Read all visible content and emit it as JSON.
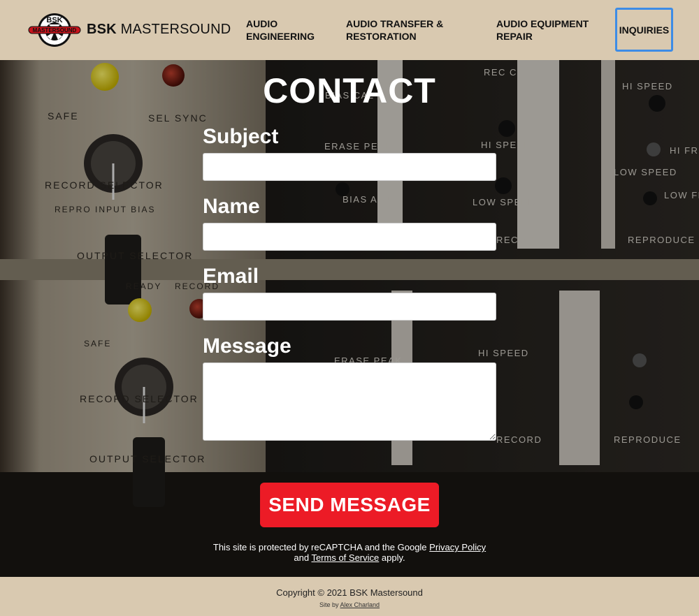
{
  "header": {
    "brand_bold": "BSK",
    "brand_rest": "MASTERSOUND",
    "logo": {
      "top_text": "BSK",
      "band_text": "MASTERSOUND"
    },
    "nav": [
      {
        "label": "AUDIO ENGINEERING"
      },
      {
        "label": "AUDIO TRANSFER & RESTORATION"
      },
      {
        "label": "AUDIO EQUIPMENT REPAIR"
      },
      {
        "label": "INQUIRIES"
      }
    ]
  },
  "hero": {
    "panel_labels": {
      "safe": "SAFE",
      "sel_sync": "SEL SYNC",
      "record_selector": "RECORD SELECTOR",
      "repro_input_bias": "REPRO  INPUT  BIAS",
      "output_selector": "OUTPUT SELECTOR",
      "ready": "READY",
      "record": "RECORD",
      "bias_cal": "BIAS CAL",
      "rec_cal": "REC CAL",
      "erase_peak": "ERASE PEAK",
      "hi_speed": "HI SPEED",
      "low_speed": "LOW SPEED",
      "bias_adj": "BIAS ADJ",
      "record_label": "RECORD",
      "reproduce": "REPRODUCE",
      "hi_freq": "HI FREQ",
      "low_freq": "LOW FREQ"
    }
  },
  "form": {
    "title": "CONTACT",
    "subject_label": "Subject",
    "name_label": "Name",
    "email_label": "Email",
    "message_label": "Message",
    "subject_value": "",
    "name_value": "",
    "email_value": "",
    "message_value": "",
    "send_label": "SEND MESSAGE"
  },
  "recaptcha": {
    "line1_prefix": "This site is protected by reCAPTCHA and the Google",
    "privacy_link": "Privacy Policy",
    "line2_prefix": "and",
    "terms_link": "Terms of Service",
    "line2_suffix": "apply."
  },
  "footer": {
    "copyright": "Copyright © 2021 BSK Mastersound",
    "credit_prefix": "Site by",
    "credit_link": "Alex Charland"
  },
  "colors": {
    "header_bg": "#d9c9b0",
    "accent_red": "#ec1b26",
    "focus_blue": "#3d8ce6"
  }
}
